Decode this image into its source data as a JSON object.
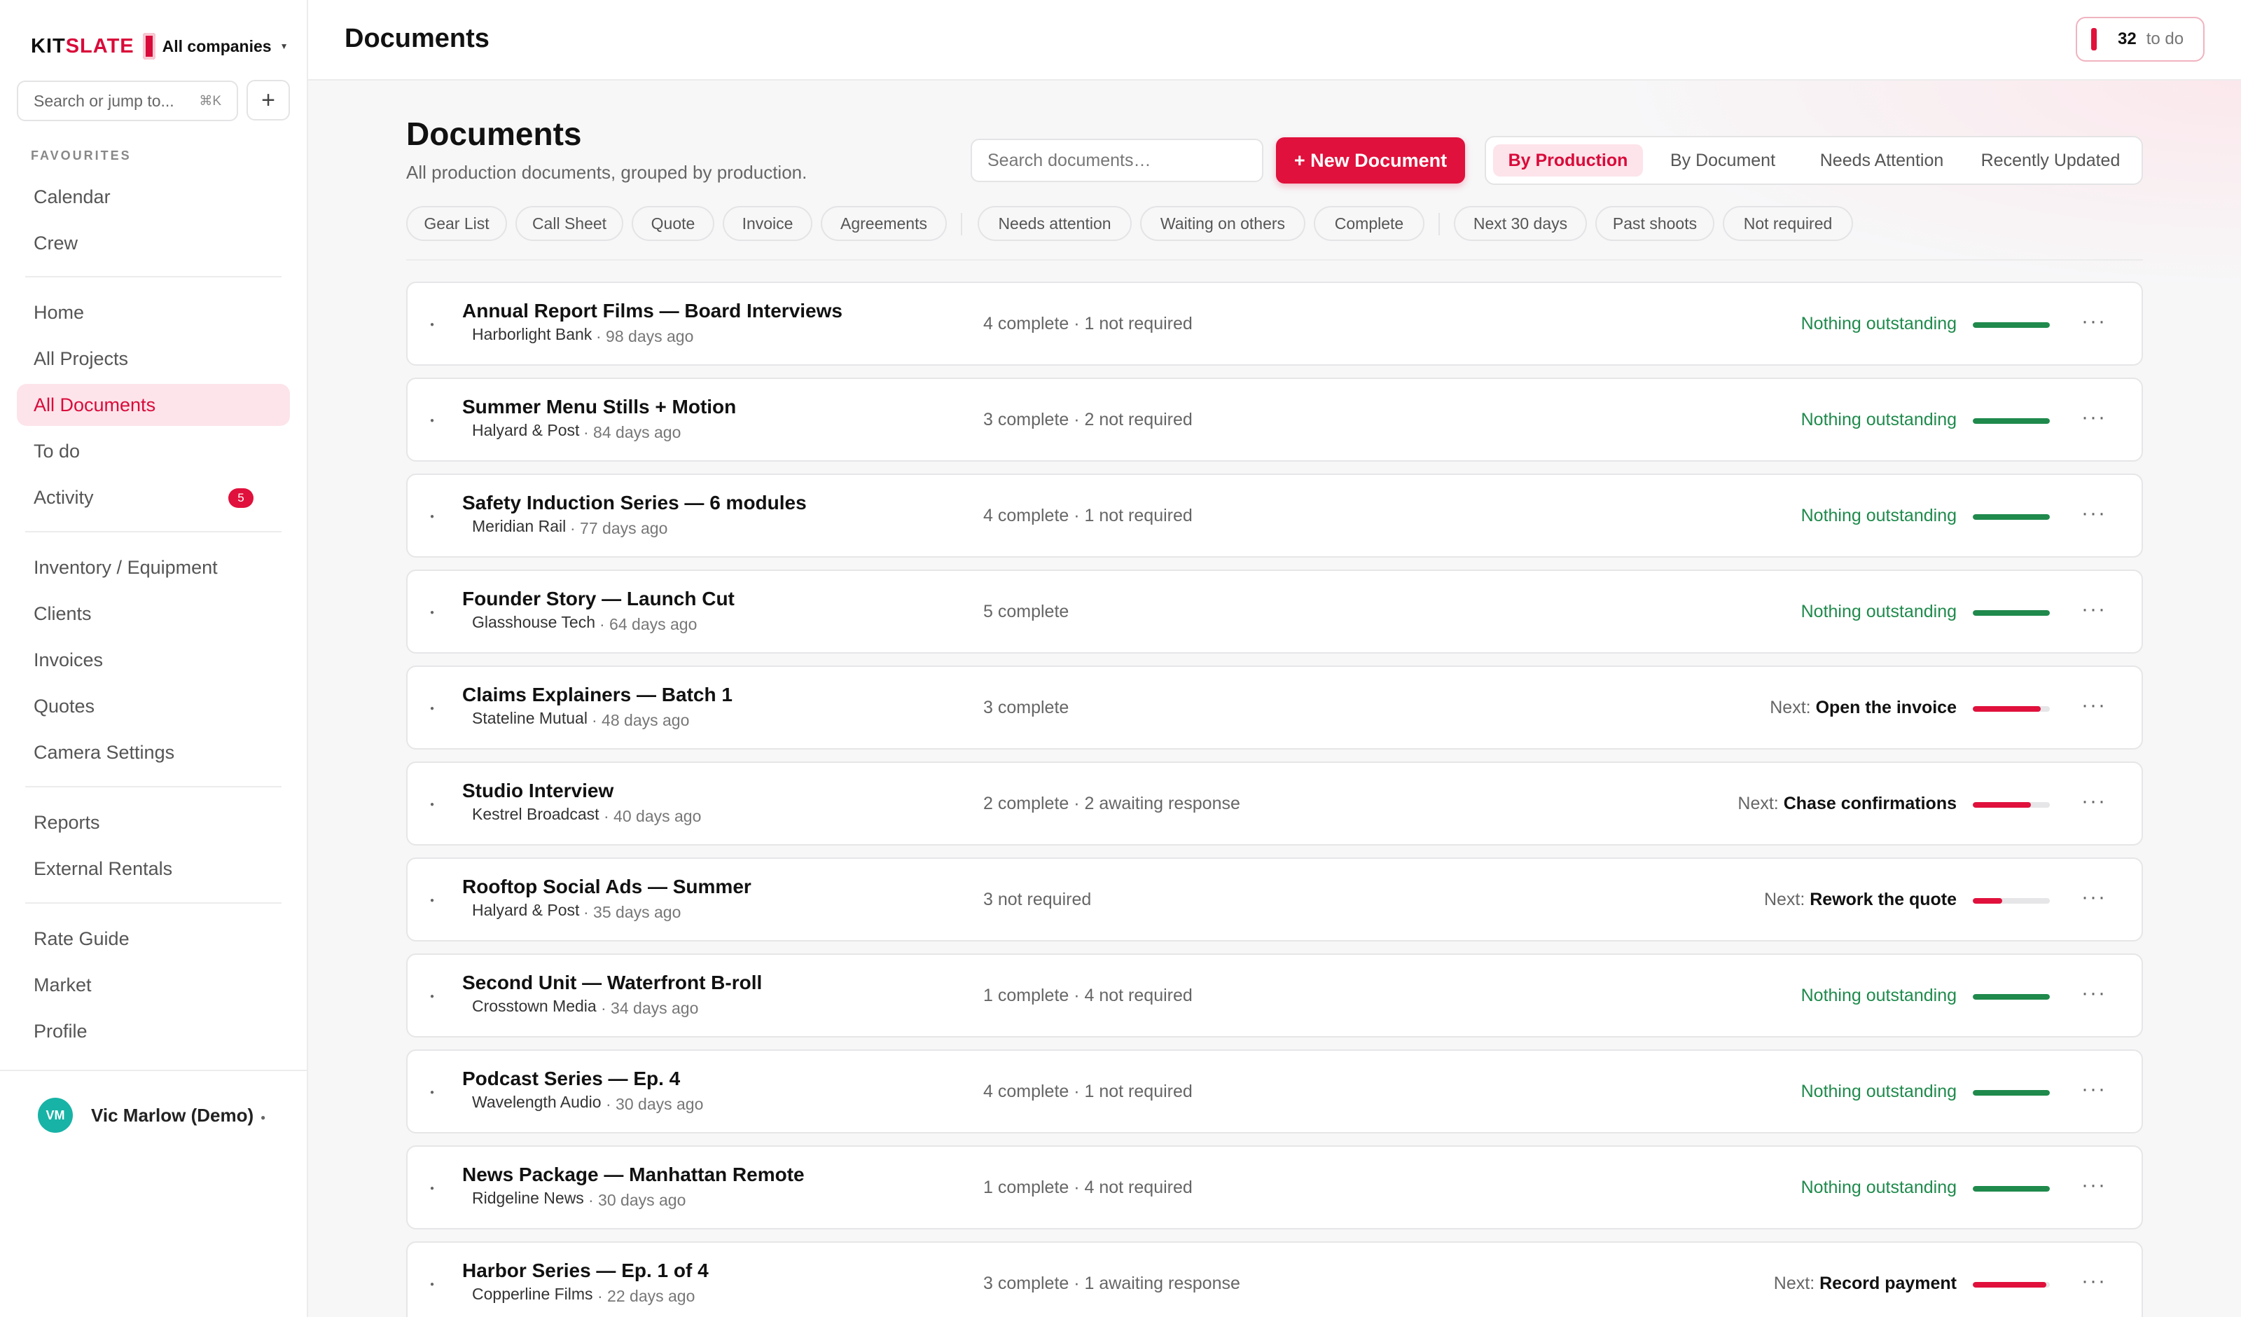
{
  "app": {
    "brand_part1": "KIT",
    "brand_part2": "SLATE",
    "company_selector": "All companies"
  },
  "sidebar": {
    "search_placeholder": "Search or jump to...",
    "search_shortcut": "⌘K",
    "add_label": "+",
    "favourites_label": "FAVOURITES",
    "favourites": [
      {
        "label": "Calendar"
      },
      {
        "label": "Crew"
      }
    ],
    "main_nav": [
      {
        "label": "Home"
      },
      {
        "label": "All Projects"
      },
      {
        "label": "All Documents",
        "active": true
      },
      {
        "label": "To do"
      },
      {
        "label": "Activity",
        "badge": "5"
      }
    ],
    "ops_nav": [
      {
        "label": "Inventory / Equipment"
      },
      {
        "label": "Clients"
      },
      {
        "label": "Invoices"
      },
      {
        "label": "Quotes"
      },
      {
        "label": "Camera Settings"
      }
    ],
    "reports_nav": [
      {
        "label": "Reports"
      },
      {
        "label": "External Rentals"
      }
    ],
    "misc_nav": [
      {
        "label": "Rate Guide"
      },
      {
        "label": "Market"
      },
      {
        "label": "Profile"
      }
    ],
    "user": {
      "initials": "VM",
      "name": "Vic Marlow (Demo)"
    }
  },
  "topbar": {
    "title": "Documents",
    "todo_count": "32",
    "todo_label": "to do"
  },
  "main": {
    "title": "Documents",
    "subtitle": "All production documents, grouped by production.",
    "search_placeholder": "Search documents…",
    "new_button": "+ New Document",
    "view_tabs": [
      {
        "label": "By Production",
        "active": true
      },
      {
        "label": "By Document"
      },
      {
        "label": "Needs Attention"
      },
      {
        "label": "Recently Updated"
      }
    ],
    "filters": {
      "types": [
        "Gear List",
        "Call Sheet",
        "Quote",
        "Invoice",
        "Agreements"
      ],
      "states": [
        "Needs attention",
        "Waiting on others",
        "Complete"
      ],
      "timing": [
        "Next 30 days",
        "Past shoots",
        "Not required"
      ]
    }
  },
  "colors": {
    "accent": "#e0113c",
    "ok": "#1f8a4c",
    "accent_soft": "#fde4ea"
  },
  "productions": [
    {
      "title": "Annual Report Films — Board Interviews",
      "client": "Harborlight Bank",
      "age": "· 98 days ago",
      "status": "4 complete · 1 not required",
      "next_label": "",
      "next_action": "Nothing outstanding",
      "ok": true,
      "progress": 1.0
    },
    {
      "title": "Summer Menu Stills + Motion",
      "client": "Halyard & Post",
      "age": "· 84 days ago",
      "status": "3 complete · 2 not required",
      "next_label": "",
      "next_action": "Nothing outstanding",
      "ok": true,
      "progress": 1.0
    },
    {
      "title": "Safety Induction Series — 6 modules",
      "client": "Meridian Rail",
      "age": "· 77 days ago",
      "status": "4 complete · 1 not required",
      "next_label": "",
      "next_action": "Nothing outstanding",
      "ok": true,
      "progress": 1.0
    },
    {
      "title": "Founder Story — Launch Cut",
      "client": "Glasshouse Tech",
      "age": "· 64 days ago",
      "status": "5 complete",
      "next_label": "",
      "next_action": "Nothing outstanding",
      "ok": true,
      "progress": 1.0
    },
    {
      "title": "Claims Explainers — Batch 1",
      "client": "Stateline Mutual",
      "age": "· 48 days ago",
      "status": "3 complete",
      "next_label": "Next:",
      "next_action": "Open the invoice",
      "ok": false,
      "progress": 0.88
    },
    {
      "title": "Studio Interview",
      "client": "Kestrel Broadcast",
      "age": "· 40 days ago",
      "status": "2 complete · 2 awaiting response",
      "next_label": "Next:",
      "next_action": "Chase confirmations",
      "ok": false,
      "progress": 0.75
    },
    {
      "title": "Rooftop Social Ads — Summer",
      "client": "Halyard & Post",
      "age": "· 35 days ago",
      "status": "3 not required",
      "next_label": "Next:",
      "next_action": "Rework the quote",
      "ok": false,
      "progress": 0.38
    },
    {
      "title": "Second Unit — Waterfront B-roll",
      "client": "Crosstown Media",
      "age": "· 34 days ago",
      "status": "1 complete · 4 not required",
      "next_label": "",
      "next_action": "Nothing outstanding",
      "ok": true,
      "progress": 1.0
    },
    {
      "title": "Podcast Series — Ep. 4",
      "client": "Wavelength Audio",
      "age": "· 30 days ago",
      "status": "4 complete · 1 not required",
      "next_label": "",
      "next_action": "Nothing outstanding",
      "ok": true,
      "progress": 1.0
    },
    {
      "title": "News Package — Manhattan Remote",
      "client": "Ridgeline News",
      "age": "· 30 days ago",
      "status": "1 complete · 4 not required",
      "next_label": "",
      "next_action": "Nothing outstanding",
      "ok": true,
      "progress": 1.0
    },
    {
      "title": "Harbor Series — Ep. 1 of 4",
      "client": "Copperline Films",
      "age": "· 22 days ago",
      "status": "3 complete · 1 awaiting response",
      "next_label": "Next:",
      "next_action": "Record payment",
      "ok": false,
      "progress": 0.95
    }
  ]
}
